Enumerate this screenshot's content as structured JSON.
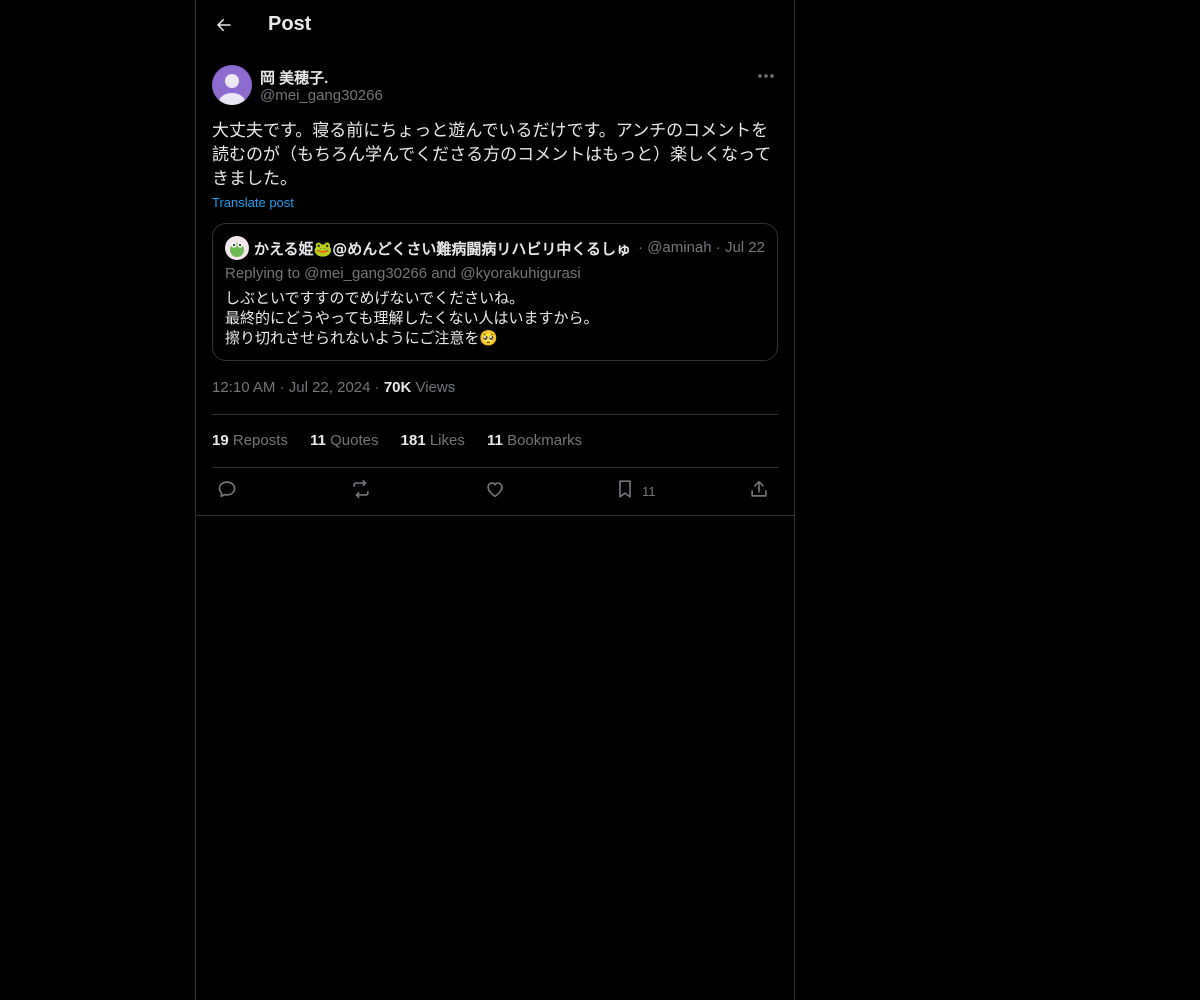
{
  "header": {
    "back_icon": "arrow-left-icon",
    "title": "Post"
  },
  "post": {
    "author_name": "岡 美穂子.",
    "author_handle": "@mei_gang30266",
    "more_icon": "more-horizontal-icon",
    "text": "大丈夫です。寝る前にちょっと遊んでいるだけです。アンチのコメントを読むのが（もちろん学んでくださる方のコメントはもっと）楽しくなってきました。",
    "translate_label": "Translate post",
    "time": "12:10 AM",
    "date": "Jul 22, 2024",
    "views_count": "70K",
    "views_label": "Views"
  },
  "quote": {
    "author_name": "かえる姫🐸@めんどくさい難病闘病リハビリ中くるしゅ",
    "author_handle": "@aminah",
    "date": "Jul 22",
    "replying_text": "Replying to @mei_gang30266 and @kyorakuhigurasi",
    "lines": [
      "しぶといですすのでめげないでくださいね。",
      "最終的にどうやっても理解したくない人はいますから。",
      "擦り切れさせられないようにご注意を🥺"
    ]
  },
  "stats": {
    "reposts_count": "19",
    "reposts_label": "Reposts",
    "quotes_count": "11",
    "quotes_label": "Quotes",
    "likes_count": "181",
    "likes_label": "Likes",
    "bookmarks_count": "11",
    "bookmarks_label": "Bookmarks"
  },
  "actions": {
    "reply_icon": "reply-icon",
    "repost_icon": "repost-icon",
    "like_icon": "heart-icon",
    "bookmark_icon": "bookmark-icon",
    "bookmark_count": "11",
    "share_icon": "share-icon"
  },
  "colors": {
    "background": "#000000",
    "text": "#e7e9ea",
    "secondary": "#71767b",
    "link": "#1d9bf0",
    "border": "#2f3336",
    "avatar": "#8e6bd1"
  }
}
